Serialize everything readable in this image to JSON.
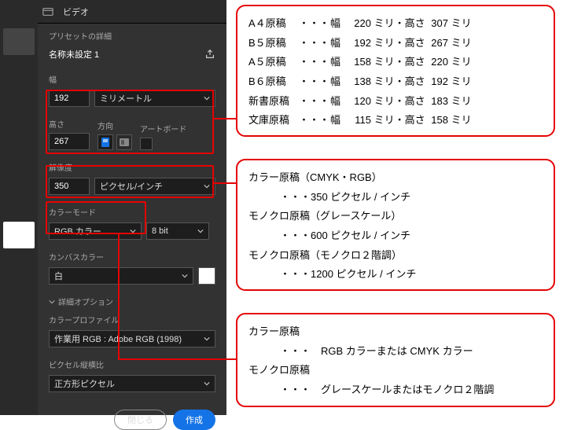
{
  "tab": {
    "title": "ビデオ"
  },
  "preset": {
    "headLabel": "プリセットの詳細",
    "name": "名称未設定 1"
  },
  "width": {
    "label": "幅",
    "value": "192"
  },
  "unit": {
    "value": "ミリメートル"
  },
  "height": {
    "label": "高さ",
    "value": "267"
  },
  "orient": {
    "label": "方向"
  },
  "artboard": {
    "label": "アートボード"
  },
  "resolution": {
    "label": "解像度",
    "value": "350",
    "unit": "ピクセル/インチ"
  },
  "colormode": {
    "label": "カラーモード",
    "value": "RGB カラー",
    "depth": "8 bit"
  },
  "canvas": {
    "label": "カンバスカラー",
    "value": "白"
  },
  "details": {
    "label": "詳細オプション"
  },
  "profile": {
    "label": "カラープロファイル",
    "value": "作業用 RGB : Adobe RGB (1998)"
  },
  "pixelaspect": {
    "label": "ピクセル縦横比",
    "value": "正方形ピクセル"
  },
  "buttons": {
    "close": "閉じる",
    "create": "作成"
  },
  "sizes": {
    "rows": [
      {
        "name": "A４原稿",
        "w": "220",
        "h": "307"
      },
      {
        "name": "B５原稿",
        "w": "192",
        "h": "267"
      },
      {
        "name": "A５原稿",
        "w": "158",
        "h": "220"
      },
      {
        "name": "B６原稿",
        "w": "138",
        "h": "192"
      },
      {
        "name": "新書原稿",
        "w": "120",
        "h": "183"
      },
      {
        "name": "文庫原稿",
        "w": "115",
        "h": "158"
      }
    ],
    "labels": {
      "dots": "・・・",
      "w": "幅",
      "milli": "ミリ・",
      "h": "高さ",
      "milliEnd": "ミリ"
    }
  },
  "reso": {
    "l1": "カラー原稿（CMYK・RGB）",
    "l2": "・・・350 ピクセル / インチ",
    "l3": "モノクロ原稿（グレースケール）",
    "l4": "・・・600 ピクセル / インチ",
    "l5": "モノクロ原稿（モノクロ２階調）",
    "l6": "・・・1200 ピクセル / インチ"
  },
  "mode": {
    "l1": "カラー原稿",
    "l2": "・・・　RGB カラーまたは CMYK カラー",
    "l3": "モノクロ原稿",
    "l4": "・・・　グレースケールまたはモノクロ２階調"
  }
}
